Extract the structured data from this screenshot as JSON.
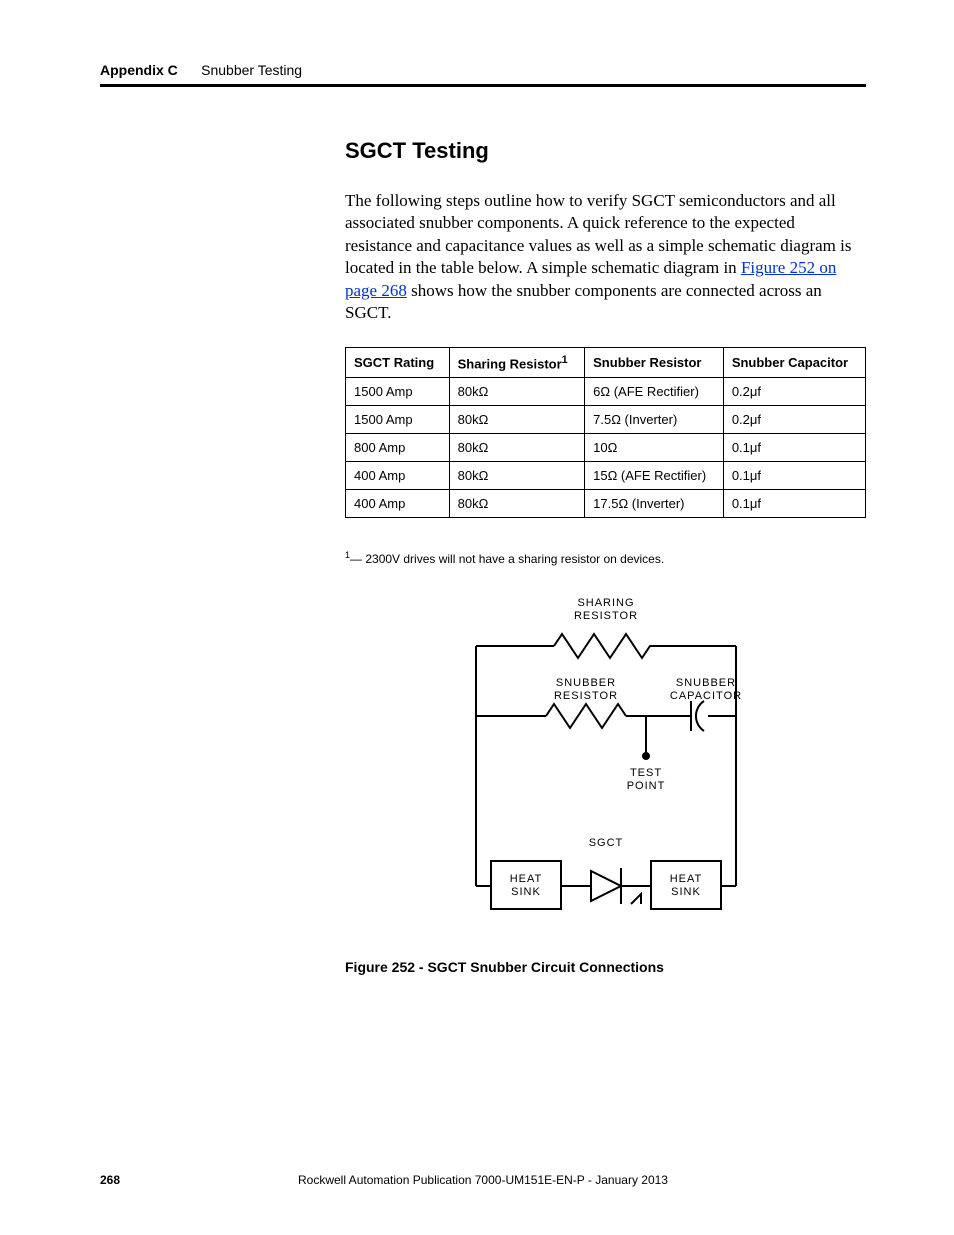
{
  "header": {
    "appendix": "Appendix C",
    "title": "Snubber Testing"
  },
  "section": {
    "heading": "SGCT Testing",
    "body_pre": "The following steps outline how to verify SGCT semiconductors and all associated snubber components. A quick reference to the expected resistance and capacitance values as well as a simple schematic diagram is located in the table below. A simple schematic diagram in ",
    "body_link": "Figure 252 on page 268",
    "body_post": " shows how the snubber components are connected across an SGCT."
  },
  "table": {
    "headers": {
      "c1": "SGCT Rating",
      "c2_pre": "Sharing Resistor",
      "c2_sup": "1",
      "c3": "Snubber Resistor",
      "c4": "Snubber Capacitor"
    },
    "rows": [
      {
        "c1": "1500 Amp",
        "c2": "80kΩ",
        "c3": "6Ω (AFE Rectifier)",
        "c4": "0.2μf"
      },
      {
        "c1": "1500 Amp",
        "c2": "80kΩ",
        "c3": "7.5Ω (Inverter)",
        "c4": "0.2μf"
      },
      {
        "c1": "800 Amp",
        "c2": "80kΩ",
        "c3": "10Ω",
        "c4": "0.1μf"
      },
      {
        "c1": "400 Amp",
        "c2": "80kΩ",
        "c3": "15Ω (AFE Rectifier)",
        "c4": "0.1μf"
      },
      {
        "c1": "400 Amp",
        "c2": "80kΩ",
        "c3": "17.5Ω (Inverter)",
        "c4": "0.1μf"
      }
    ]
  },
  "footnote": {
    "sup": "1",
    "text": "— 2300V drives will not have a sharing resistor on devices."
  },
  "figure": {
    "labels": {
      "sharing1": "SHARING",
      "sharing2": "RESISTOR",
      "snub_r1": "SNUBBER",
      "snub_r2": "RESISTOR",
      "snub_c1": "SNUBBER",
      "snub_c2": "CAPACITOR",
      "tp1": "TEST",
      "tp2": "POINT",
      "sgct": "SGCT",
      "hs1a": "HEAT",
      "hs1b": "SINK",
      "hs2a": "HEAT",
      "hs2b": "SINK"
    },
    "caption": "Figure 252 - SGCT Snubber Circuit Connections"
  },
  "footer": {
    "page": "268",
    "publication": "Rockwell Automation Publication 7000-UM151E-EN-P - January 2013"
  }
}
